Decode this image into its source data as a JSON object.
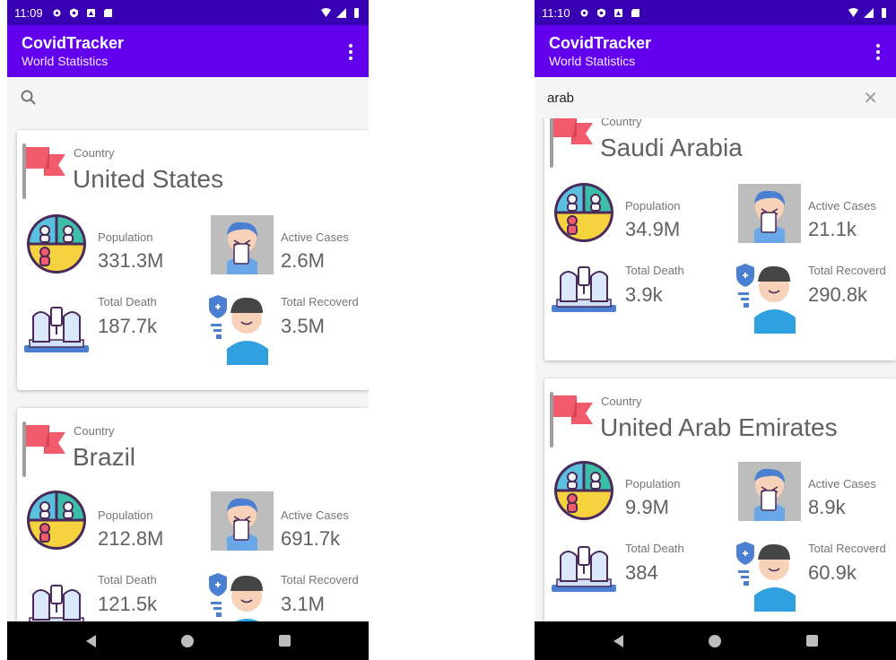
{
  "colors": {
    "status_bar": "#3700b3",
    "app_bar": "#6200ee",
    "flag": "#f25b6c",
    "text": "#616161"
  },
  "icons": {
    "country": "red-flag-icon",
    "population": "population-pie-icon",
    "active": "sick-person-icon",
    "death": "deceased-feet-icon",
    "recovered": "recovered-person-icon"
  },
  "screens": [
    {
      "status_time": "11:09",
      "app_title": "CovidTracker",
      "app_subtitle": "World Statistics",
      "search_value": "",
      "cards": [
        {
          "country_label": "Country",
          "country": "United States",
          "population_label": "Population",
          "population": "331.3M",
          "active_label": "Active Cases",
          "active": "2.6M",
          "death_label": "Total Death",
          "death": "187.7k",
          "recovered_label": "Total Recoverd",
          "recovered": "3.5M"
        },
        {
          "country_label": "Country",
          "country": "Brazil",
          "population_label": "Population",
          "population": "212.8M",
          "active_label": "Active Cases",
          "active": "691.7k",
          "death_label": "Total Death",
          "death": "121.5k",
          "recovered_label": "Total Recoverd",
          "recovered": "3.1M"
        }
      ]
    },
    {
      "status_time": "11:10",
      "app_title": "CovidTracker",
      "app_subtitle": "World Statistics",
      "search_value": "arab",
      "cards": [
        {
          "country_label": "Country",
          "country": "Saudi Arabia",
          "population_label": "Population",
          "population": "34.9M",
          "active_label": "Active Cases",
          "active": "21.1k",
          "death_label": "Total Death",
          "death": "3.9k",
          "recovered_label": "Total Recoverd",
          "recovered": "290.8k"
        },
        {
          "country_label": "Country",
          "country": "United Arab Emirates",
          "population_label": "Population",
          "population": "9.9M",
          "active_label": "Active Cases",
          "active": "8.9k",
          "death_label": "Total Death",
          "death": "384",
          "recovered_label": "Total Recoverd",
          "recovered": "60.9k"
        }
      ]
    }
  ]
}
